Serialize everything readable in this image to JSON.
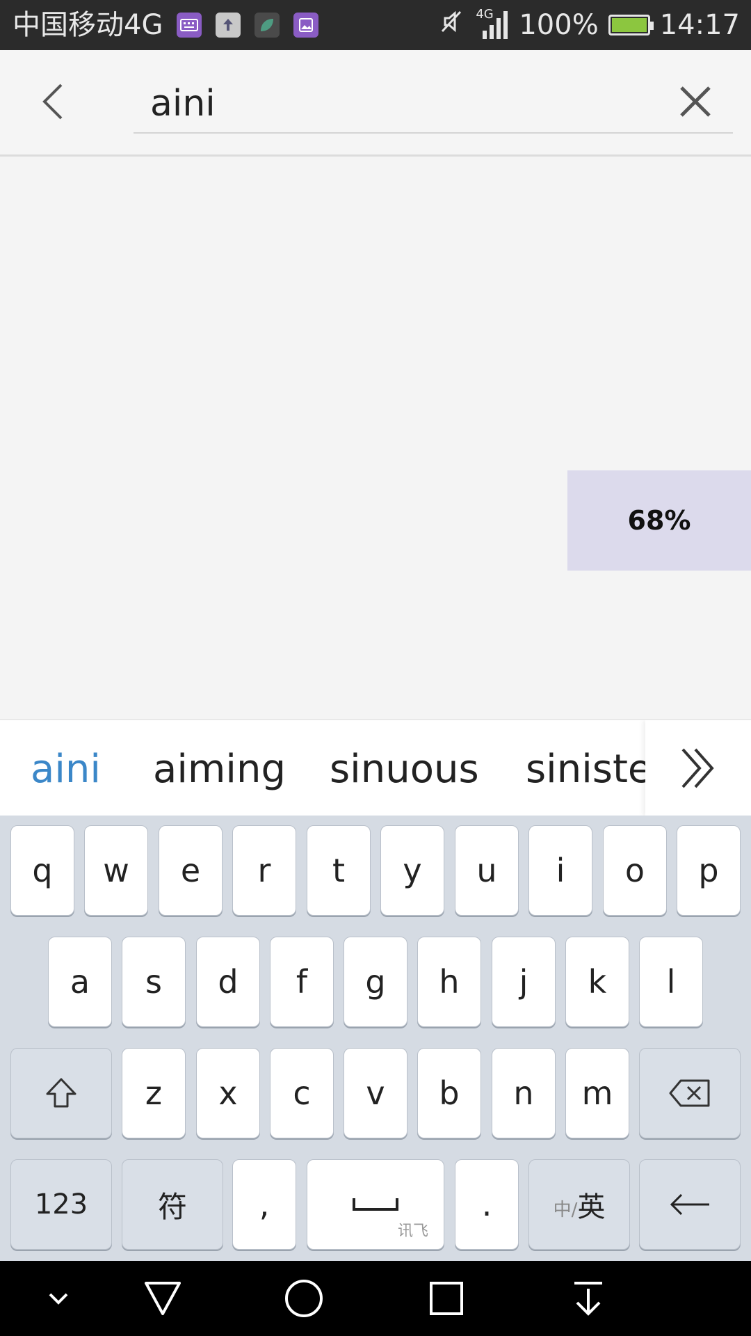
{
  "status_bar": {
    "carrier": "中国移动4G",
    "network": "4G",
    "battery": "100%",
    "time": "14:17",
    "battery_level": 1.0
  },
  "search": {
    "query": "aini"
  },
  "overlay": {
    "percent": "68%"
  },
  "suggestions": [
    "aini",
    "aiming",
    "sinuous",
    "siniste"
  ],
  "keyboard": {
    "row1": [
      "q",
      "w",
      "e",
      "r",
      "t",
      "y",
      "u",
      "i",
      "o",
      "p"
    ],
    "row2": [
      "a",
      "s",
      "d",
      "f",
      "g",
      "h",
      "j",
      "k",
      "l"
    ],
    "row3": [
      "z",
      "x",
      "c",
      "v",
      "b",
      "n",
      "m"
    ],
    "num_label": "123",
    "symbol_label": "符",
    "comma": ",",
    "period": ".",
    "space_brand": "讯飞",
    "lang_small": "中/",
    "lang_big": "英"
  },
  "colors": {
    "accent": "#3b87c8",
    "keyboard_bg": "#d5dbe3",
    "overlay_bg": "#dcdaec"
  }
}
